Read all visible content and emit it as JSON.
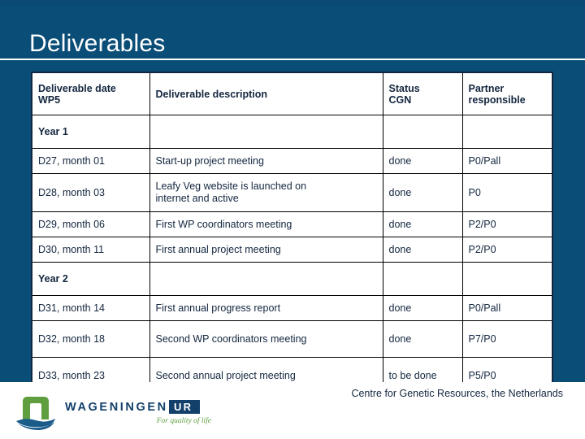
{
  "slide": {
    "title": "Deliverables",
    "background_color": "#0a4e78",
    "title_color": "#ffffff"
  },
  "table": {
    "headers": {
      "date": "Deliverable date WP5",
      "date_line1": "Deliverable date",
      "date_line2": "WP5",
      "description": "Deliverable description",
      "status": "Status CGN",
      "status_line1": "Status",
      "status_line2": "CGN",
      "partner": "Partner responsible",
      "partner_line1": "Partner",
      "partner_line2": "responsible"
    },
    "sections": [
      {
        "label": "Year 1",
        "rows": [
          {
            "date": "D27, month 01",
            "description": "Start-up project meeting",
            "status": "done",
            "partner": "P0/Pall"
          },
          {
            "date": "D28, month 03",
            "description_line1": "Leafy Veg website is launched on",
            "description_line2": "internet and active",
            "description": "Leafy Veg website is launched on internet and active",
            "status": "done",
            "partner": "P0"
          },
          {
            "date": "D29, month 06",
            "description": "First WP coordinators meeting",
            "status": "done",
            "partner": "P2/P0"
          },
          {
            "date": "D30, month 11",
            "description": "First annual project meeting",
            "status": "done",
            "partner": "P2/P0"
          }
        ]
      },
      {
        "label": "Year 2",
        "rows": [
          {
            "date": "D31, month 14",
            "description": "First annual progress report",
            "status": "done",
            "partner": "P0/Pall"
          },
          {
            "date": "D32, month 18",
            "description": "Second WP coordinators meeting",
            "status": "done",
            "partner": "P7/P0"
          },
          {
            "date": "D33, month 23",
            "description": "Second annual project meeting",
            "status": "to be done",
            "partner": "P5/P0"
          }
        ]
      }
    ]
  },
  "footer": {
    "text": "Centre for Genetic Resources, the Netherlands",
    "text_color": "#13263f"
  },
  "logo": {
    "wordmark": "WAGENINGEN",
    "ur": "UR",
    "tagline": "For quality of life",
    "mark_color": "#5e9e3e",
    "swoosh_color": "#1b5b8a",
    "wordmark_color": "#13406b",
    "tagline_color": "#5e9e3e"
  }
}
